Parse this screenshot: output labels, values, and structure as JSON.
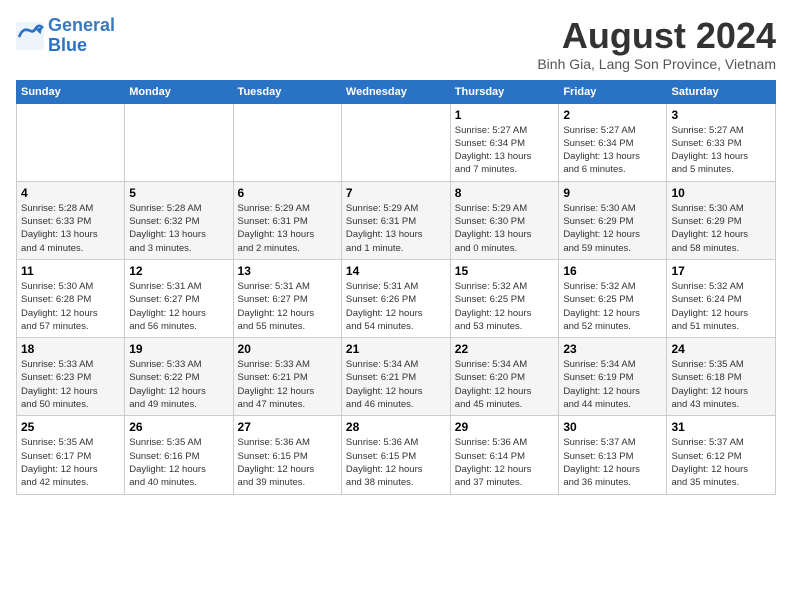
{
  "header": {
    "logo_line1": "General",
    "logo_line2": "Blue",
    "title": "August 2024",
    "subtitle": "Binh Gia, Lang Son Province, Vietnam"
  },
  "columns": [
    "Sunday",
    "Monday",
    "Tuesday",
    "Wednesday",
    "Thursday",
    "Friday",
    "Saturday"
  ],
  "weeks": [
    [
      {
        "day": "",
        "info": ""
      },
      {
        "day": "",
        "info": ""
      },
      {
        "day": "",
        "info": ""
      },
      {
        "day": "",
        "info": ""
      },
      {
        "day": "1",
        "info": "Sunrise: 5:27 AM\nSunset: 6:34 PM\nDaylight: 13 hours\nand 7 minutes."
      },
      {
        "day": "2",
        "info": "Sunrise: 5:27 AM\nSunset: 6:34 PM\nDaylight: 13 hours\nand 6 minutes."
      },
      {
        "day": "3",
        "info": "Sunrise: 5:27 AM\nSunset: 6:33 PM\nDaylight: 13 hours\nand 5 minutes."
      }
    ],
    [
      {
        "day": "4",
        "info": "Sunrise: 5:28 AM\nSunset: 6:33 PM\nDaylight: 13 hours\nand 4 minutes."
      },
      {
        "day": "5",
        "info": "Sunrise: 5:28 AM\nSunset: 6:32 PM\nDaylight: 13 hours\nand 3 minutes."
      },
      {
        "day": "6",
        "info": "Sunrise: 5:29 AM\nSunset: 6:31 PM\nDaylight: 13 hours\nand 2 minutes."
      },
      {
        "day": "7",
        "info": "Sunrise: 5:29 AM\nSunset: 6:31 PM\nDaylight: 13 hours\nand 1 minute."
      },
      {
        "day": "8",
        "info": "Sunrise: 5:29 AM\nSunset: 6:30 PM\nDaylight: 13 hours\nand 0 minutes."
      },
      {
        "day": "9",
        "info": "Sunrise: 5:30 AM\nSunset: 6:29 PM\nDaylight: 12 hours\nand 59 minutes."
      },
      {
        "day": "10",
        "info": "Sunrise: 5:30 AM\nSunset: 6:29 PM\nDaylight: 12 hours\nand 58 minutes."
      }
    ],
    [
      {
        "day": "11",
        "info": "Sunrise: 5:30 AM\nSunset: 6:28 PM\nDaylight: 12 hours\nand 57 minutes."
      },
      {
        "day": "12",
        "info": "Sunrise: 5:31 AM\nSunset: 6:27 PM\nDaylight: 12 hours\nand 56 minutes."
      },
      {
        "day": "13",
        "info": "Sunrise: 5:31 AM\nSunset: 6:27 PM\nDaylight: 12 hours\nand 55 minutes."
      },
      {
        "day": "14",
        "info": "Sunrise: 5:31 AM\nSunset: 6:26 PM\nDaylight: 12 hours\nand 54 minutes."
      },
      {
        "day": "15",
        "info": "Sunrise: 5:32 AM\nSunset: 6:25 PM\nDaylight: 12 hours\nand 53 minutes."
      },
      {
        "day": "16",
        "info": "Sunrise: 5:32 AM\nSunset: 6:25 PM\nDaylight: 12 hours\nand 52 minutes."
      },
      {
        "day": "17",
        "info": "Sunrise: 5:32 AM\nSunset: 6:24 PM\nDaylight: 12 hours\nand 51 minutes."
      }
    ],
    [
      {
        "day": "18",
        "info": "Sunrise: 5:33 AM\nSunset: 6:23 PM\nDaylight: 12 hours\nand 50 minutes."
      },
      {
        "day": "19",
        "info": "Sunrise: 5:33 AM\nSunset: 6:22 PM\nDaylight: 12 hours\nand 49 minutes."
      },
      {
        "day": "20",
        "info": "Sunrise: 5:33 AM\nSunset: 6:21 PM\nDaylight: 12 hours\nand 47 minutes."
      },
      {
        "day": "21",
        "info": "Sunrise: 5:34 AM\nSunset: 6:21 PM\nDaylight: 12 hours\nand 46 minutes."
      },
      {
        "day": "22",
        "info": "Sunrise: 5:34 AM\nSunset: 6:20 PM\nDaylight: 12 hours\nand 45 minutes."
      },
      {
        "day": "23",
        "info": "Sunrise: 5:34 AM\nSunset: 6:19 PM\nDaylight: 12 hours\nand 44 minutes."
      },
      {
        "day": "24",
        "info": "Sunrise: 5:35 AM\nSunset: 6:18 PM\nDaylight: 12 hours\nand 43 minutes."
      }
    ],
    [
      {
        "day": "25",
        "info": "Sunrise: 5:35 AM\nSunset: 6:17 PM\nDaylight: 12 hours\nand 42 minutes."
      },
      {
        "day": "26",
        "info": "Sunrise: 5:35 AM\nSunset: 6:16 PM\nDaylight: 12 hours\nand 40 minutes."
      },
      {
        "day": "27",
        "info": "Sunrise: 5:36 AM\nSunset: 6:15 PM\nDaylight: 12 hours\nand 39 minutes."
      },
      {
        "day": "28",
        "info": "Sunrise: 5:36 AM\nSunset: 6:15 PM\nDaylight: 12 hours\nand 38 minutes."
      },
      {
        "day": "29",
        "info": "Sunrise: 5:36 AM\nSunset: 6:14 PM\nDaylight: 12 hours\nand 37 minutes."
      },
      {
        "day": "30",
        "info": "Sunrise: 5:37 AM\nSunset: 6:13 PM\nDaylight: 12 hours\nand 36 minutes."
      },
      {
        "day": "31",
        "info": "Sunrise: 5:37 AM\nSunset: 6:12 PM\nDaylight: 12 hours\nand 35 minutes."
      }
    ]
  ]
}
